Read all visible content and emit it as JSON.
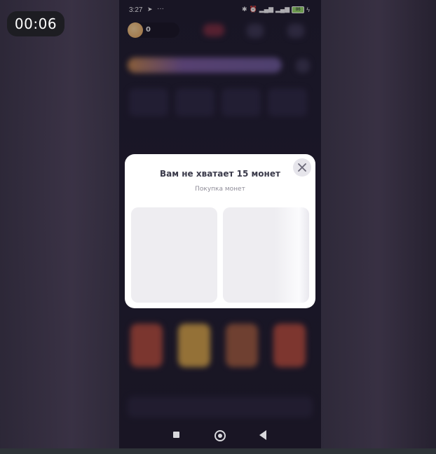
{
  "recording_timer": "00:06",
  "status_bar": {
    "time": "3:27",
    "battery": "86"
  },
  "header": {
    "coin_count": "0"
  },
  "dialog": {
    "title": "Вам не хватает 15 монет",
    "subtitle": "Покупка монет",
    "close_icon": "close-x"
  },
  "colors": {
    "dialog_background": "#ffffff",
    "offer_card": "#eeedf1",
    "app_background": "#1c1828"
  },
  "icons": {
    "nav_recent": "square",
    "nav_home": "circle",
    "nav_back": "triangle"
  }
}
